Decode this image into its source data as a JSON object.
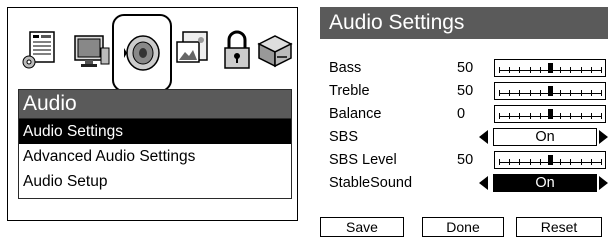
{
  "left_panel": {
    "icons": [
      "picture-settings-icon",
      "display-settings-icon",
      "audio-speaker-icon",
      "photo-viewer-icon",
      "lock-icon",
      "setup-box-icon"
    ],
    "selected_icon": "audio-speaker-icon",
    "menu_title": "Audio",
    "menu_items": [
      "Audio Settings",
      "Advanced Audio Settings",
      "Audio Setup"
    ]
  },
  "right_panel": {
    "title": "Audio Settings",
    "settings": [
      {
        "label": "Bass",
        "value": "50",
        "control": "slider",
        "level": 0.5
      },
      {
        "label": "Treble",
        "value": "50",
        "control": "slider",
        "level": 0.5
      },
      {
        "label": "Balance",
        "value": "0",
        "control": "slider",
        "level": 0.5
      },
      {
        "label": "SBS",
        "value": "",
        "control": "selector",
        "option": "On"
      },
      {
        "label": "SBS Level",
        "value": "50",
        "control": "slider",
        "level": 0.5
      },
      {
        "label": "StableSound",
        "value": "",
        "control": "selector",
        "option": "On",
        "active": true
      }
    ],
    "buttons": [
      "Save",
      "Done",
      "Reset"
    ]
  },
  "colors": {
    "header_bg": "#5a5a5a",
    "highlight_bg": "#000000",
    "highlight_text": "#ffffff"
  }
}
